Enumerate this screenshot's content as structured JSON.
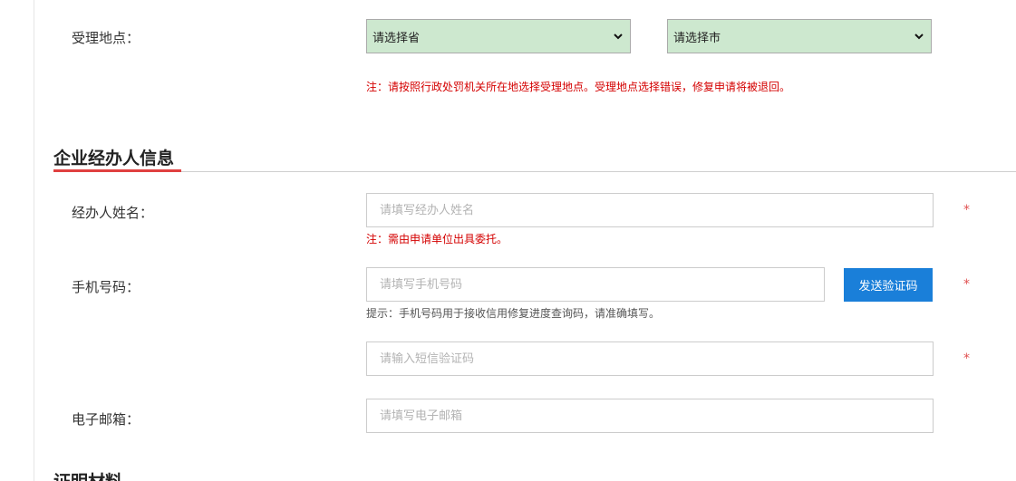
{
  "location": {
    "label": "受理地点：",
    "province_select": "请选择省",
    "city_select": "请选择市",
    "note": "注：请按照行政处罚机关所在地选择受理地点。受理地点选择错误，修复申请将被退回。"
  },
  "agent_section": {
    "title": "企业经办人信息",
    "name": {
      "label": "经办人姓名：",
      "placeholder": "请填写经办人姓名",
      "note": "注：需由申请单位出具委托。",
      "required_mark": "*"
    },
    "phone": {
      "label": "手机号码：",
      "placeholder": "请填写手机号码",
      "send_code_button": "发送验证码",
      "hint": "提示：手机号码用于接收信用修复进度查询码，请准确填写。",
      "required_mark": "*"
    },
    "sms_code": {
      "placeholder": "请输入短信验证码",
      "required_mark": "*"
    },
    "email": {
      "label": "电子邮箱：",
      "placeholder": "请填写电子邮箱"
    }
  },
  "next_section": {
    "title": "证明材料"
  },
  "colors": {
    "select_bg": "#cde8cf",
    "note_red": "#d40000",
    "accent_underline": "#e04040",
    "button_blue": "#1a7fd9",
    "required_star": "#e05050"
  }
}
